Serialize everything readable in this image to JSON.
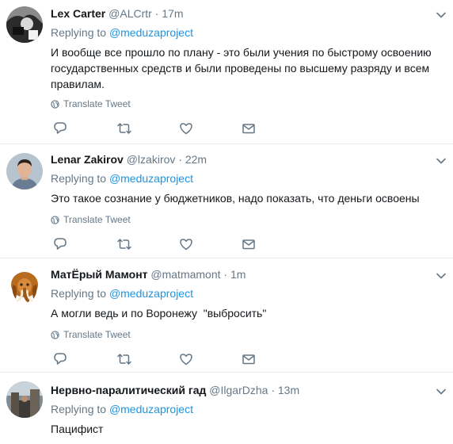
{
  "tweets": [
    {
      "name": "Lex Carter",
      "handle": "@ALCrtr",
      "sep": "·",
      "time": "17m",
      "replying_prefix": "Replying to",
      "replying_to": "@meduzaproject",
      "text": "И вообще все прошло по плану - это были учения по быстрому освоению государственных средств и были проведены по высшему разряду и всем правилам.",
      "translate": "Translate Tweet"
    },
    {
      "name": "Lenar Zakirov",
      "handle": "@lzakirov",
      "sep": "·",
      "time": "22m",
      "replying_prefix": "Replying to",
      "replying_to": "@meduzaproject",
      "text": "Это такое сознание у бюджетников, надо показать, что деньги освоены",
      "translate": "Translate Tweet"
    },
    {
      "name": "МатЁрый Мамонт",
      "handle": "@matmamont",
      "sep": "·",
      "time": "1m",
      "replying_prefix": "Replying to",
      "replying_to": "@meduzaproject",
      "text": "А могли ведь и по Воронежу  \"выбросить\"",
      "translate": "Translate Tweet"
    },
    {
      "name": "Нервно-паралитический гад",
      "handle": "@IlgarDzha",
      "sep": "·",
      "time": "13m",
      "replying_prefix": "Replying to",
      "replying_to": "@meduzaproject",
      "text": "Пацифист"
    }
  ],
  "icons": {
    "reply": "reply-icon",
    "retweet": "retweet-icon",
    "like": "heart-icon",
    "dm": "envelope-icon",
    "globe": "globe-icon",
    "more": "chevron-down-icon"
  },
  "colors": {
    "link": "#1b95e0",
    "muted": "#657786",
    "text": "#14171a",
    "divider": "#e6ecf0"
  }
}
